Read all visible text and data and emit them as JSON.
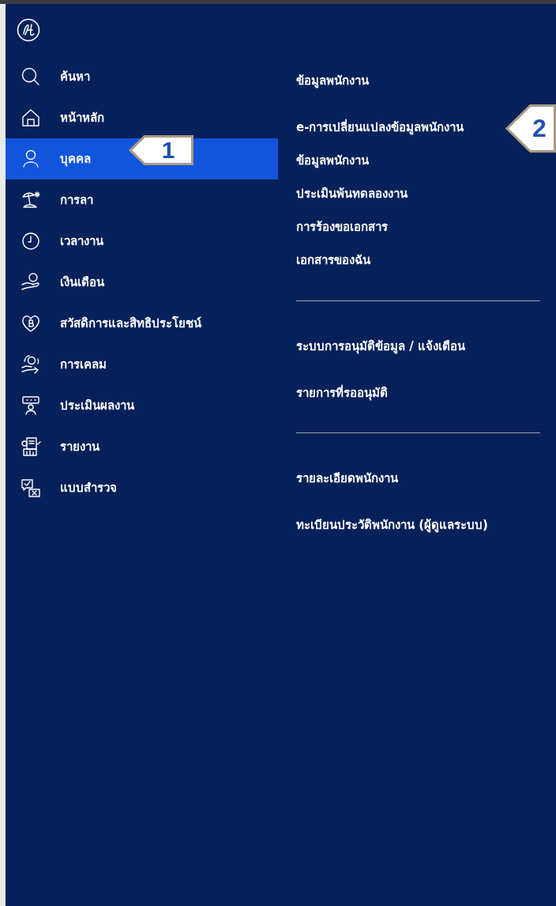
{
  "sidebar": {
    "items": [
      {
        "label": "ค้นหา",
        "kind": "search",
        "selected": false
      },
      {
        "label": "หน้าหลัก",
        "kind": "home",
        "selected": false
      },
      {
        "label": "บุคคล",
        "kind": "person",
        "selected": true,
        "callout": "1"
      },
      {
        "label": "การลา",
        "kind": "beach",
        "selected": false
      },
      {
        "label": "เวลางาน",
        "kind": "clock",
        "selected": false
      },
      {
        "label": "เงินเดือน",
        "kind": "salary",
        "selected": false
      },
      {
        "label": "สวัสดิการและสิทธิประโยชน์",
        "kind": "benefit",
        "selected": false
      },
      {
        "label": "การเคลม",
        "kind": "claim",
        "selected": false
      },
      {
        "label": "ประเมินผลงาน",
        "kind": "evaluation",
        "selected": false
      },
      {
        "label": "รายงาน",
        "kind": "report",
        "selected": false
      },
      {
        "label": "แบบสำรวจ",
        "kind": "survey",
        "selected": false
      }
    ]
  },
  "submenu": {
    "groups": [
      {
        "items": [
          {
            "label": "ข้อมูลพนักงาน",
            "kind": "heading"
          },
          {
            "label": "e-การเปลี่ยนแปลงข้อมูลพนักงาน",
            "kind": "link",
            "callout": "2"
          },
          {
            "label": "ข้อมูลพนักงาน",
            "kind": "link"
          },
          {
            "label": "ประเมินพ้นทดลองงาน",
            "kind": "link"
          },
          {
            "label": "การร้องขอเอกสาร",
            "kind": "link"
          },
          {
            "label": "เอกสารของฉัน",
            "kind": "link"
          }
        ]
      },
      {
        "items": [
          {
            "label": "ระบบการอนุมัติข้อมูล / แจ้งเตือน",
            "kind": "link"
          },
          {
            "label": "รายการที่รออนุมัติ",
            "kind": "link"
          }
        ]
      },
      {
        "items": [
          {
            "label": "รายละเอียดพนักงาน",
            "kind": "link"
          },
          {
            "label": "ทะเบียนประวัติพนักงาน (ผู้ดูแลระบบ)",
            "kind": "link"
          }
        ]
      }
    ]
  }
}
